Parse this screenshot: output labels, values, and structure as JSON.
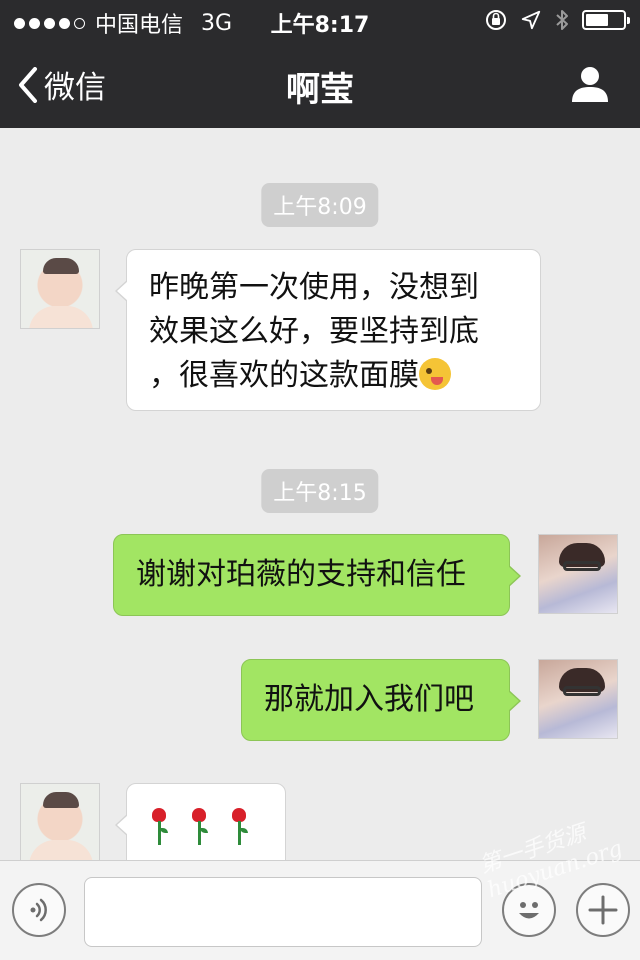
{
  "status_bar": {
    "carrier": "中国电信",
    "network": "3G",
    "time": "上午8:17",
    "battery_level": 0.55
  },
  "nav": {
    "back_label": "微信",
    "title": "啊莹",
    "profile_icon": "person-icon"
  },
  "messages": [
    {
      "type": "timestamp",
      "text": "上午8:09"
    },
    {
      "type": "incoming",
      "avatar": "baby",
      "lines": [
        "昨晚第一次使用，没想到",
        "效果这么好，要坚持到底",
        "，很喜欢的这款面膜"
      ],
      "emoji": "winking-tongue-face"
    },
    {
      "type": "timestamp",
      "text": "上午8:15"
    },
    {
      "type": "outgoing",
      "avatar": "woman",
      "text": "谢谢对珀薇的支持和信任"
    },
    {
      "type": "outgoing",
      "avatar": "woman",
      "text": "那就加入我们吧"
    },
    {
      "type": "incoming",
      "avatar": "baby",
      "emoji_sequence": [
        "rose",
        "rose",
        "rose"
      ]
    }
  ],
  "input_bar": {
    "voice_icon": "voice-icon",
    "emoji_icon": "smiley-icon",
    "more_icon": "plus-icon",
    "text_value": ""
  },
  "watermark": {
    "logo_text": "第一手货源",
    "site_text": "huoyuan.org"
  },
  "colors": {
    "nav_bg": "#2b2b2d",
    "chat_bg": "#ececec",
    "outgoing_bubble": "#a2e563",
    "incoming_bubble": "#ffffff",
    "timestamp_bg": "#cfcfcf"
  }
}
